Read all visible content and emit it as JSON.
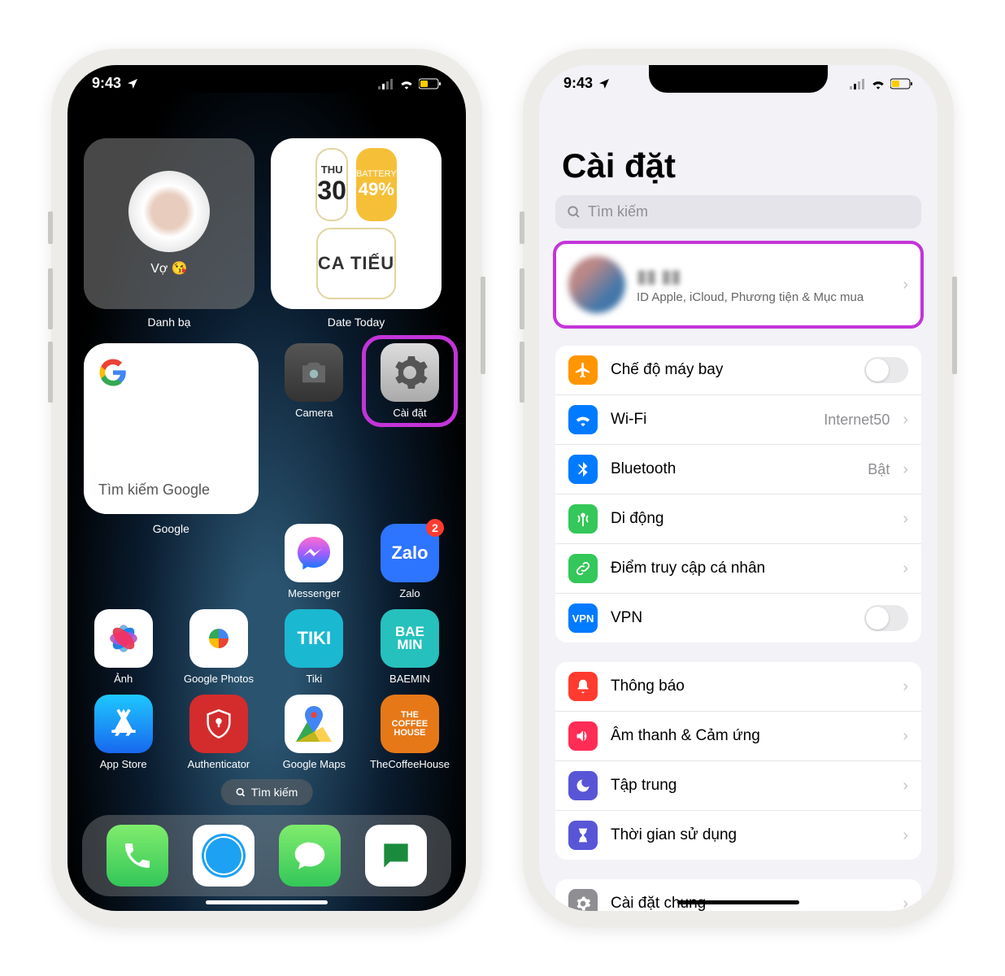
{
  "status": {
    "time": "9:43"
  },
  "home": {
    "contact_widget_name": "Vợ 😘",
    "contact_widget_label": "Danh bạ",
    "date_widget": {
      "day_label": "THU",
      "day_num": "30",
      "battery_label": "BATTERY",
      "battery_pct": "49%",
      "event": "CA TIẾU",
      "label": "Date Today"
    },
    "google_widget": {
      "search_label": "Tìm kiếm Google",
      "label": "Google"
    },
    "apps": {
      "camera": "Camera",
      "settings": "Cài đặt",
      "messenger": "Messenger",
      "zalo": "Zalo",
      "photos": "Ảnh",
      "gphotos": "Google Photos",
      "tiki": "Tiki",
      "baemin": "BAEMIN",
      "appstore": "App Store",
      "auth": "Authenticator",
      "maps": "Google Maps",
      "coffee": "TheCoffeeHouse"
    },
    "zalo_badge": "2",
    "search_pill": "Tìm kiếm"
  },
  "settings": {
    "title": "Cài đặt",
    "search_placeholder": "Tìm kiếm",
    "profile_sub": "ID Apple, iCloud, Phương tiện & Mục mua",
    "rows": {
      "airplane": "Chế độ máy bay",
      "wifi": "Wi-Fi",
      "wifi_val": "Internet50",
      "bt": "Bluetooth",
      "bt_val": "Bật",
      "cell": "Di động",
      "hotspot": "Điểm truy cập cá nhân",
      "vpn": "VPN",
      "notif": "Thông báo",
      "sound": "Âm thanh & Cảm ứng",
      "focus": "Tập trung",
      "screentime": "Thời gian sử dụng",
      "general": "Cài đặt chung"
    }
  }
}
